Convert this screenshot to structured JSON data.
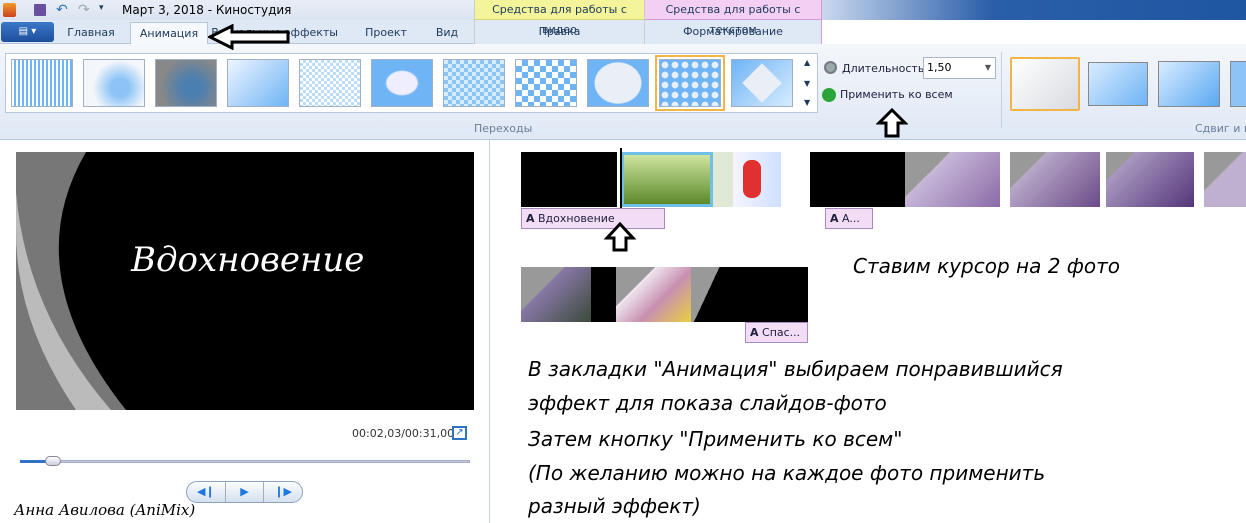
{
  "window": {
    "title": "Март 3, 2018 - Киностудия"
  },
  "context_groups": [
    {
      "label": "Средства для работы с видео",
      "tab": "Правка",
      "color": "#f4f59a"
    },
    {
      "label": "Средства для работы с текстом",
      "tab": "Форматирование",
      "color": "#f3d0f3"
    }
  ],
  "tabs": [
    {
      "label": "Главная"
    },
    {
      "label": "Анимация",
      "active": true
    },
    {
      "label": "Визуальные эффекты"
    },
    {
      "label": "Проект"
    },
    {
      "label": "Вид"
    }
  ],
  "ribbon": {
    "transitions_group": "Переходы",
    "duration_label": "Длительность:",
    "duration_value": "1,50",
    "apply_all": "Применить ко всем",
    "pan_zoom_group": "Сдвиг и м",
    "selected_transition_index": 9
  },
  "preview": {
    "slide_title": "Вдохновение",
    "time": "00:02,03/00:31,00",
    "progress": 0.065
  },
  "storyboard": {
    "captions": [
      "Вдохновение",
      "A...",
      "Спас..."
    ]
  },
  "annotations": {
    "cursor_note": "Ставим курсор на 2 фото",
    "lines": [
      "В закладки \"Анимация\" выбираем понравившийся",
      "эффект для показа слайдов-фото",
      "Затем кнопку \"Применить ко всем\"",
      "(По желанию можно на каждое фото применить",
      "разный эффект)"
    ],
    "signature": "Анна Авилова (AniMix)"
  }
}
